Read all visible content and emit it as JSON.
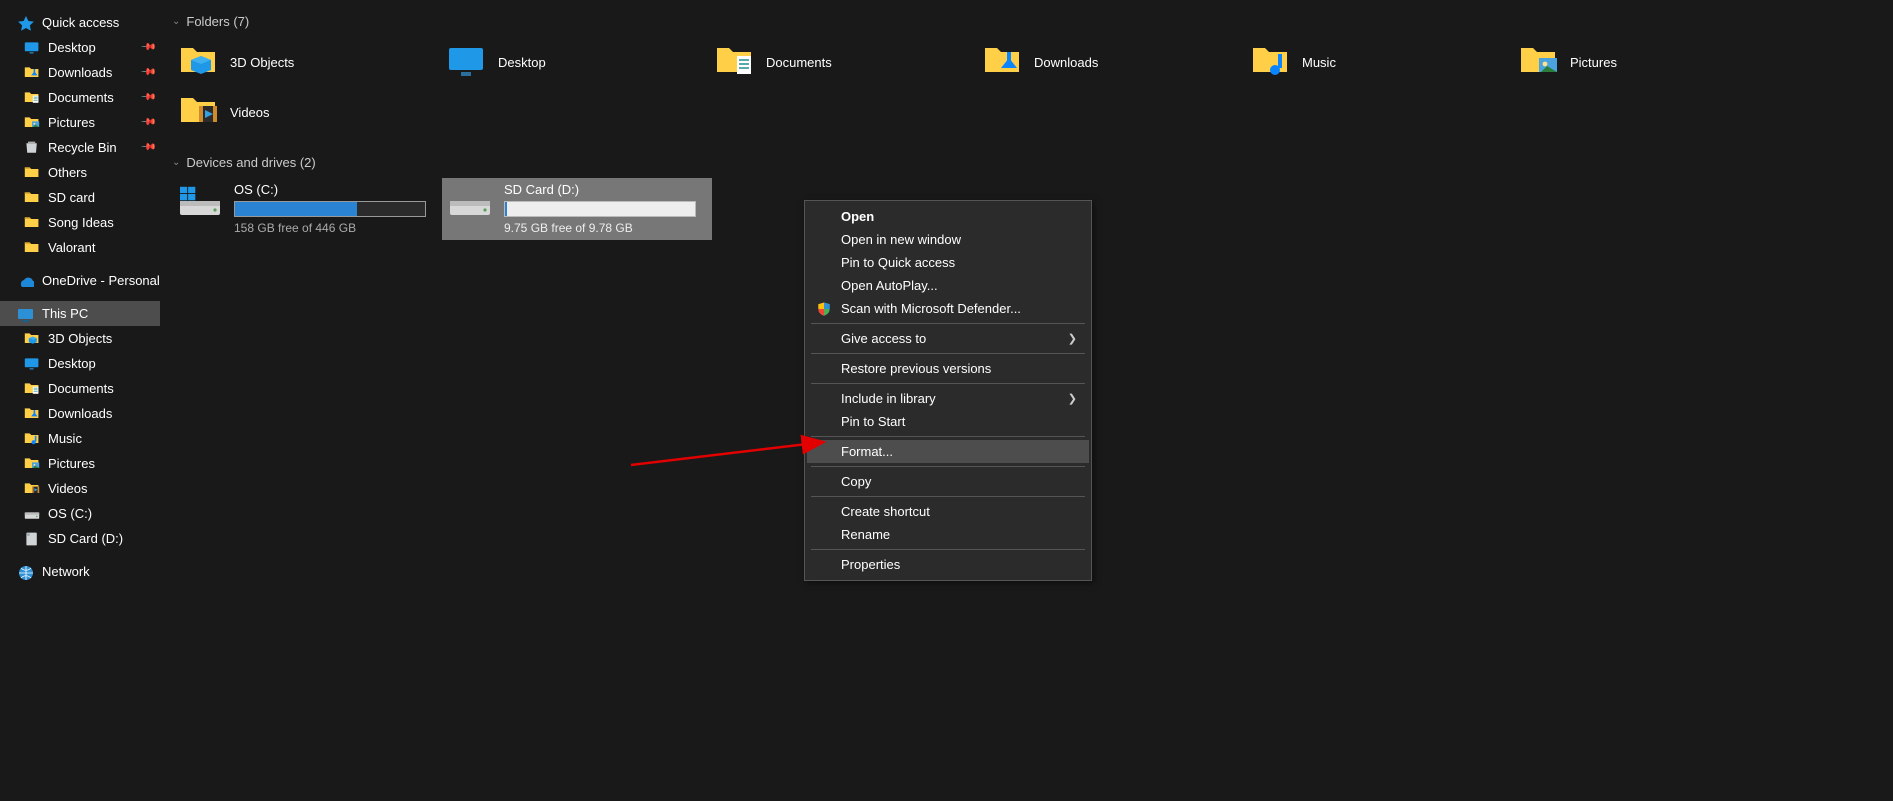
{
  "nav": {
    "quick_access": "Quick access",
    "qa_items": [
      {
        "label": "Desktop",
        "ico": "desktop",
        "pin": true
      },
      {
        "label": "Downloads",
        "ico": "download",
        "pin": true
      },
      {
        "label": "Documents",
        "ico": "documents",
        "pin": true
      },
      {
        "label": "Pictures",
        "ico": "pictures",
        "pin": true
      },
      {
        "label": "Recycle Bin",
        "ico": "recycle",
        "pin": true
      },
      {
        "label": "Others",
        "ico": "folder",
        "pin": false
      },
      {
        "label": "SD card",
        "ico": "folder",
        "pin": false
      },
      {
        "label": "Song Ideas",
        "ico": "folder",
        "pin": false
      },
      {
        "label": "Valorant",
        "ico": "folder",
        "pin": false
      }
    ],
    "onedrive": "OneDrive - Personal",
    "this_pc": "This PC",
    "pc_items": [
      {
        "label": "3D Objects",
        "ico": "3d"
      },
      {
        "label": "Desktop",
        "ico": "desktop"
      },
      {
        "label": "Documents",
        "ico": "documents"
      },
      {
        "label": "Downloads",
        "ico": "download"
      },
      {
        "label": "Music",
        "ico": "music"
      },
      {
        "label": "Pictures",
        "ico": "pictures"
      },
      {
        "label": "Videos",
        "ico": "videos"
      },
      {
        "label": "OS (C:)",
        "ico": "drive"
      },
      {
        "label": "SD Card (D:)",
        "ico": "sdcard"
      }
    ],
    "network": "Network"
  },
  "folders_hdr": "Folders (7)",
  "folders": [
    {
      "label": "3D Objects",
      "ico": "3d"
    },
    {
      "label": "Desktop",
      "ico": "desktop"
    },
    {
      "label": "Documents",
      "ico": "documents"
    },
    {
      "label": "Downloads",
      "ico": "download"
    },
    {
      "label": "Music",
      "ico": "music"
    },
    {
      "label": "Pictures",
      "ico": "pictures"
    },
    {
      "label": "Videos",
      "ico": "videos"
    }
  ],
  "drives_hdr": "Devices and drives (2)",
  "drives": {
    "os": {
      "name": "OS (C:)",
      "free": "158 GB free of 446 GB"
    },
    "sd": {
      "name": "SD Card (D:)",
      "free": "9.75 GB free of 9.78 GB"
    }
  },
  "ctx": {
    "open": "Open",
    "open_new": "Open in new window",
    "pin_qa": "Pin to Quick access",
    "autoplay": "Open AutoPlay...",
    "defender": "Scan with Microsoft Defender...",
    "give_access": "Give access to",
    "restore": "Restore previous versions",
    "include_lib": "Include in library",
    "pin_start": "Pin to Start",
    "format": "Format...",
    "copy": "Copy",
    "shortcut": "Create shortcut",
    "rename": "Rename",
    "properties": "Properties"
  }
}
